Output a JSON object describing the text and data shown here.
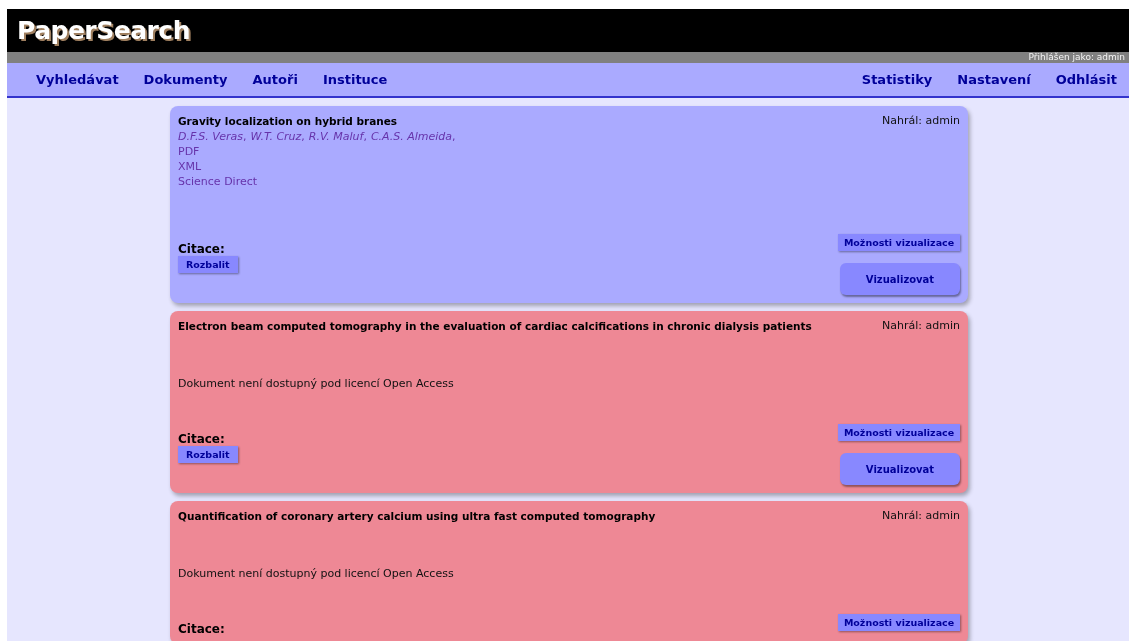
{
  "header": {
    "logo": "PaperSearch",
    "login_status": "Přihlášen jako: admin"
  },
  "nav": {
    "left": [
      "Vyhledávat",
      "Dokumenty",
      "Autoři",
      "Instituce"
    ],
    "right": [
      "Statistiky",
      "Nastavení",
      "Odhlásit"
    ]
  },
  "documents": [
    {
      "title": "Gravity localization on hybrid branes",
      "uploader": "Nahrál: admin",
      "available": true,
      "authors": [
        {
          "name": "D.F.S. Veras",
          "separator": ","
        },
        {
          "name": "W.T. Cruz",
          "separator": ","
        },
        {
          "name": "R.V. Maluf",
          "separator": ","
        },
        {
          "name": "C.A.S. Almeida",
          "separator": ","
        }
      ],
      "links": [
        "PDF",
        "XML",
        "Science Direct"
      ],
      "citations_label": "Citace:",
      "expand_button": "Rozbalit",
      "options_button": "Možnosti vizualizace",
      "visualize_button": "Vizualizovat"
    },
    {
      "title": "Electron beam computed tomography in the evaluation of cardiac calcifications in chronic dialysis patients",
      "uploader": "Nahrál: admin",
      "available": false,
      "notice": "Dokument není dostupný pod licencí Open Access",
      "citations_label": "Citace:",
      "expand_button": "Rozbalit",
      "options_button": "Možnosti vizualizace",
      "visualize_button": "Vizualizovat"
    },
    {
      "title": "Quantification of coronary artery calcium using ultra fast computed tomography",
      "uploader": "Nahrál: admin",
      "available": false,
      "notice": "Dokument není dostupný pod licencí Open Access",
      "citations_label": "Citace:",
      "options_button": "Možnosti vizualizace"
    }
  ]
}
